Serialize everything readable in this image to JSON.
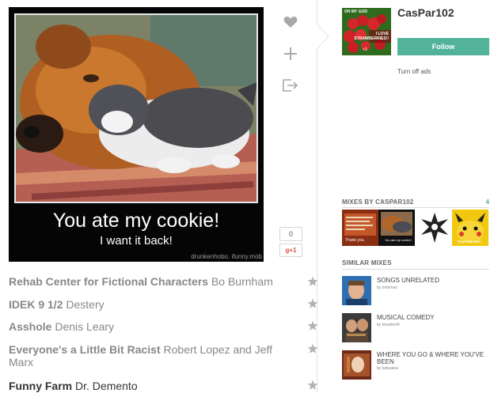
{
  "cover": {
    "caption_line1": "You ate my cookie!",
    "caption_line2": "I want it back!",
    "watermark": "drunkenhobo. ifunny.mob"
  },
  "actions": {
    "like_icon": "heart-icon",
    "add_icon": "plus-icon",
    "share_icon": "share-icon",
    "share_count": "0",
    "gplus_label": "g+1"
  },
  "user": {
    "name": "CasPar102",
    "follow_label": "Follow",
    "turn_off_ads": "Turn off ads",
    "avatar_text_top": "OH MY GOD",
    "avatar_text_mid1": "I LOVE",
    "avatar_text_mid2": "STRAWBERRIES!!",
    "avatar_text_bottom": "<3"
  },
  "mixes_by": {
    "heading": "MIXES BY CASPAR102",
    "count": "4",
    "thumb1_text": "Thank you.",
    "thumb2_text": "You ate my cookie!",
    "thumb4_text": "TRUE RED SUN"
  },
  "similar": {
    "heading": "SIMILAR MIXES",
    "items": [
      {
        "title": "SONGS UNRELATED",
        "by": "by smbrnan"
      },
      {
        "title": "MUSICAL COMEDY",
        "by": "by kmadent9"
      },
      {
        "title": "WHERE YOU GO & WHERE YOU'VE BEEN",
        "by": "by katyuana"
      }
    ]
  },
  "tracks": [
    {
      "title": "Rehab Center for Fictional Characters",
      "artist": "Bo Burnham"
    },
    {
      "title": "IDEK 9 1/2",
      "artist": "Destery"
    },
    {
      "title": "Asshole",
      "artist": "Denis Leary"
    },
    {
      "title": "Everyone's a Little Bit Racist",
      "artist": "Robert Lopez and Jeff Marx"
    },
    {
      "title": "Funny Farm",
      "artist": "Dr. Demento"
    }
  ],
  "colors": {
    "accent": "#52b39a",
    "icon_gray": "#a8a8a8"
  }
}
